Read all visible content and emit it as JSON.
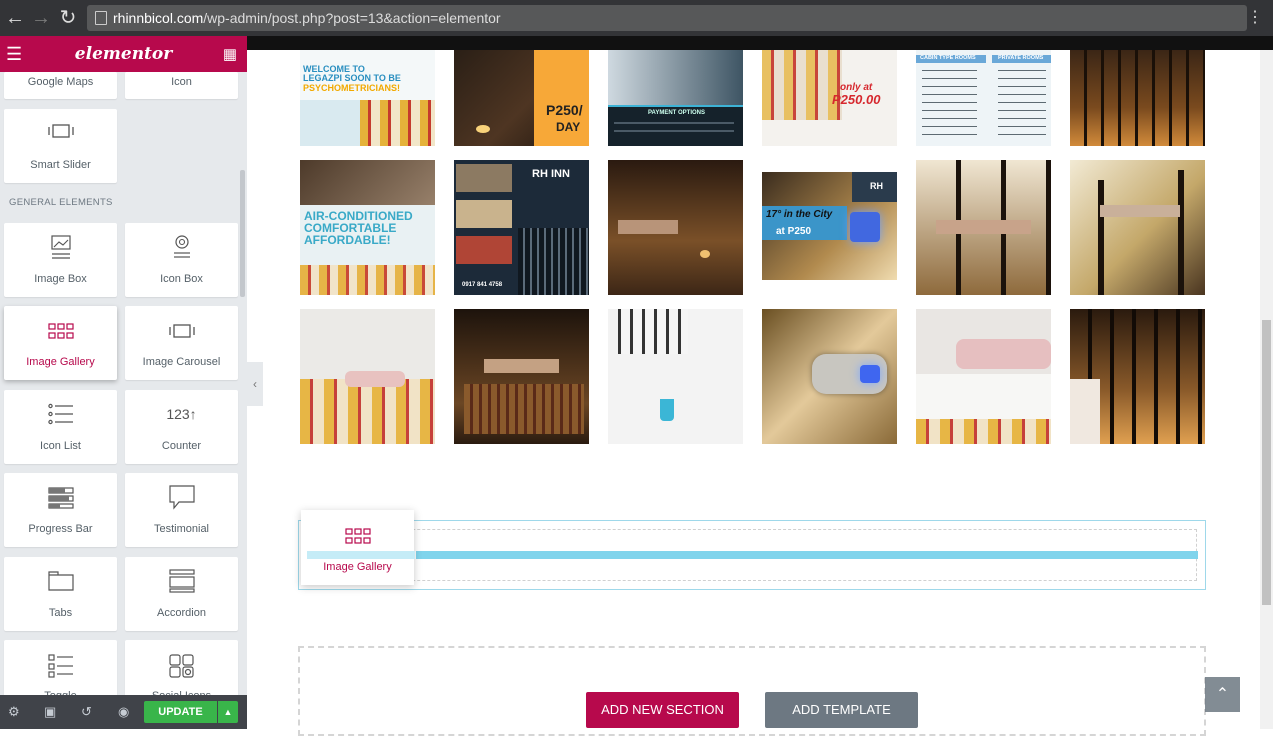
{
  "browser": {
    "url_host": "rhinnbicol.com",
    "url_path": "/wp-admin/post.php?post=13&action=elementor"
  },
  "sidebar": {
    "logo": "elementor",
    "basic_widgets": [
      {
        "label": "Google Maps"
      },
      {
        "label": "Icon"
      },
      {
        "label": "Smart Slider"
      }
    ],
    "section_title": "GENERAL ELEMENTS",
    "general_widgets": [
      {
        "label": "Image Box",
        "icon": "image-box-icon"
      },
      {
        "label": "Icon Box",
        "icon": "icon-box-icon"
      },
      {
        "label": "Image Gallery",
        "icon": "image-gallery-icon"
      },
      {
        "label": "Image Carousel",
        "icon": "image-carousel-icon"
      },
      {
        "label": "Icon List",
        "icon": "icon-list-icon"
      },
      {
        "label": "Counter",
        "icon": "counter-icon"
      },
      {
        "label": "Progress Bar",
        "icon": "progress-bar-icon"
      },
      {
        "label": "Testimonial",
        "icon": "testimonial-icon"
      },
      {
        "label": "Tabs",
        "icon": "tabs-icon"
      },
      {
        "label": "Accordion",
        "icon": "accordion-icon"
      },
      {
        "label": "Toggle",
        "icon": "toggle-icon"
      },
      {
        "label": "Social Icons",
        "icon": "social-icons-icon"
      }
    ],
    "counter_glyph": "123",
    "footer": {
      "update_label": "UPDATE"
    }
  },
  "gallery": {
    "row1": [
      {
        "lines": [
          "WELCOME TO",
          "LEGAZPI SOON TO BE",
          "PSYCHOMETRICIANS!"
        ]
      },
      {
        "lines": [
          "P250/",
          "DAY"
        ]
      },
      {
        "lines": [
          "PAYMENT OPTIONS"
        ]
      },
      {
        "lines": [
          "only at",
          "P250.00"
        ]
      },
      {
        "lines": [
          "CABIN TYPE ROOMS",
          "PRIVATE ROOMS"
        ]
      },
      {
        "lines": []
      }
    ],
    "row2": [
      {
        "lines": [
          "AIR-CONDITIONED",
          "COMFORTABLE",
          "AFFORDABLE!"
        ]
      },
      {
        "lines": [
          "RH INN",
          "0917 841 4758"
        ]
      },
      {
        "lines": []
      },
      {
        "lines": [
          "RH",
          "17° in the City",
          "at P250"
        ]
      },
      {
        "lines": []
      },
      {
        "lines": []
      }
    ]
  },
  "drag": {
    "label": "Image Gallery"
  },
  "actions": {
    "add_section": "ADD NEW SECTION",
    "add_template": "ADD TEMPLATE"
  }
}
